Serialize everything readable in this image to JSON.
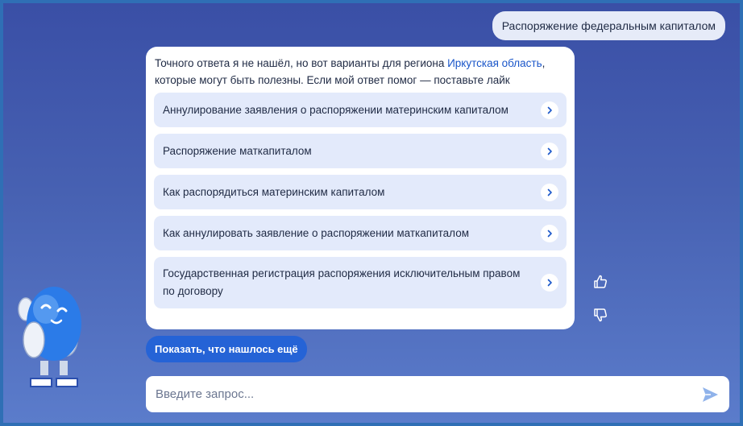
{
  "chat": {
    "user_message": "Распоряжение федеральным капиталом",
    "answer_intro_before": "Точного ответа я не нашёл, но вот варианты для региона ",
    "answer_region_link": "Иркутская область",
    "answer_intro_after": ", которые могут быть полезны. Если мой ответ помог — поставьте лайк",
    "options": [
      {
        "label": "Аннулирование заявления о распоряжении материнским капиталом"
      },
      {
        "label": "Распоряжение маткапиталом"
      },
      {
        "label": "Как распорядиться материнским капиталом"
      },
      {
        "label": "Как аннулировать заявление о распоряжении маткапиталом"
      },
      {
        "label": "Государственная регистрация распоряжения исключительным правом по договору"
      }
    ],
    "show_more_label": "Показать, что нашлось ещё"
  },
  "input": {
    "placeholder": "Введите запрос..."
  },
  "icons": {
    "option_chevron": "chevron-right-icon",
    "like": "thumbs-up-icon",
    "dislike": "thumbs-down-icon",
    "send": "send-icon"
  },
  "colors": {
    "accent": "#2563d6",
    "link": "#1a56c9",
    "option_bg": "#e3eafb"
  }
}
